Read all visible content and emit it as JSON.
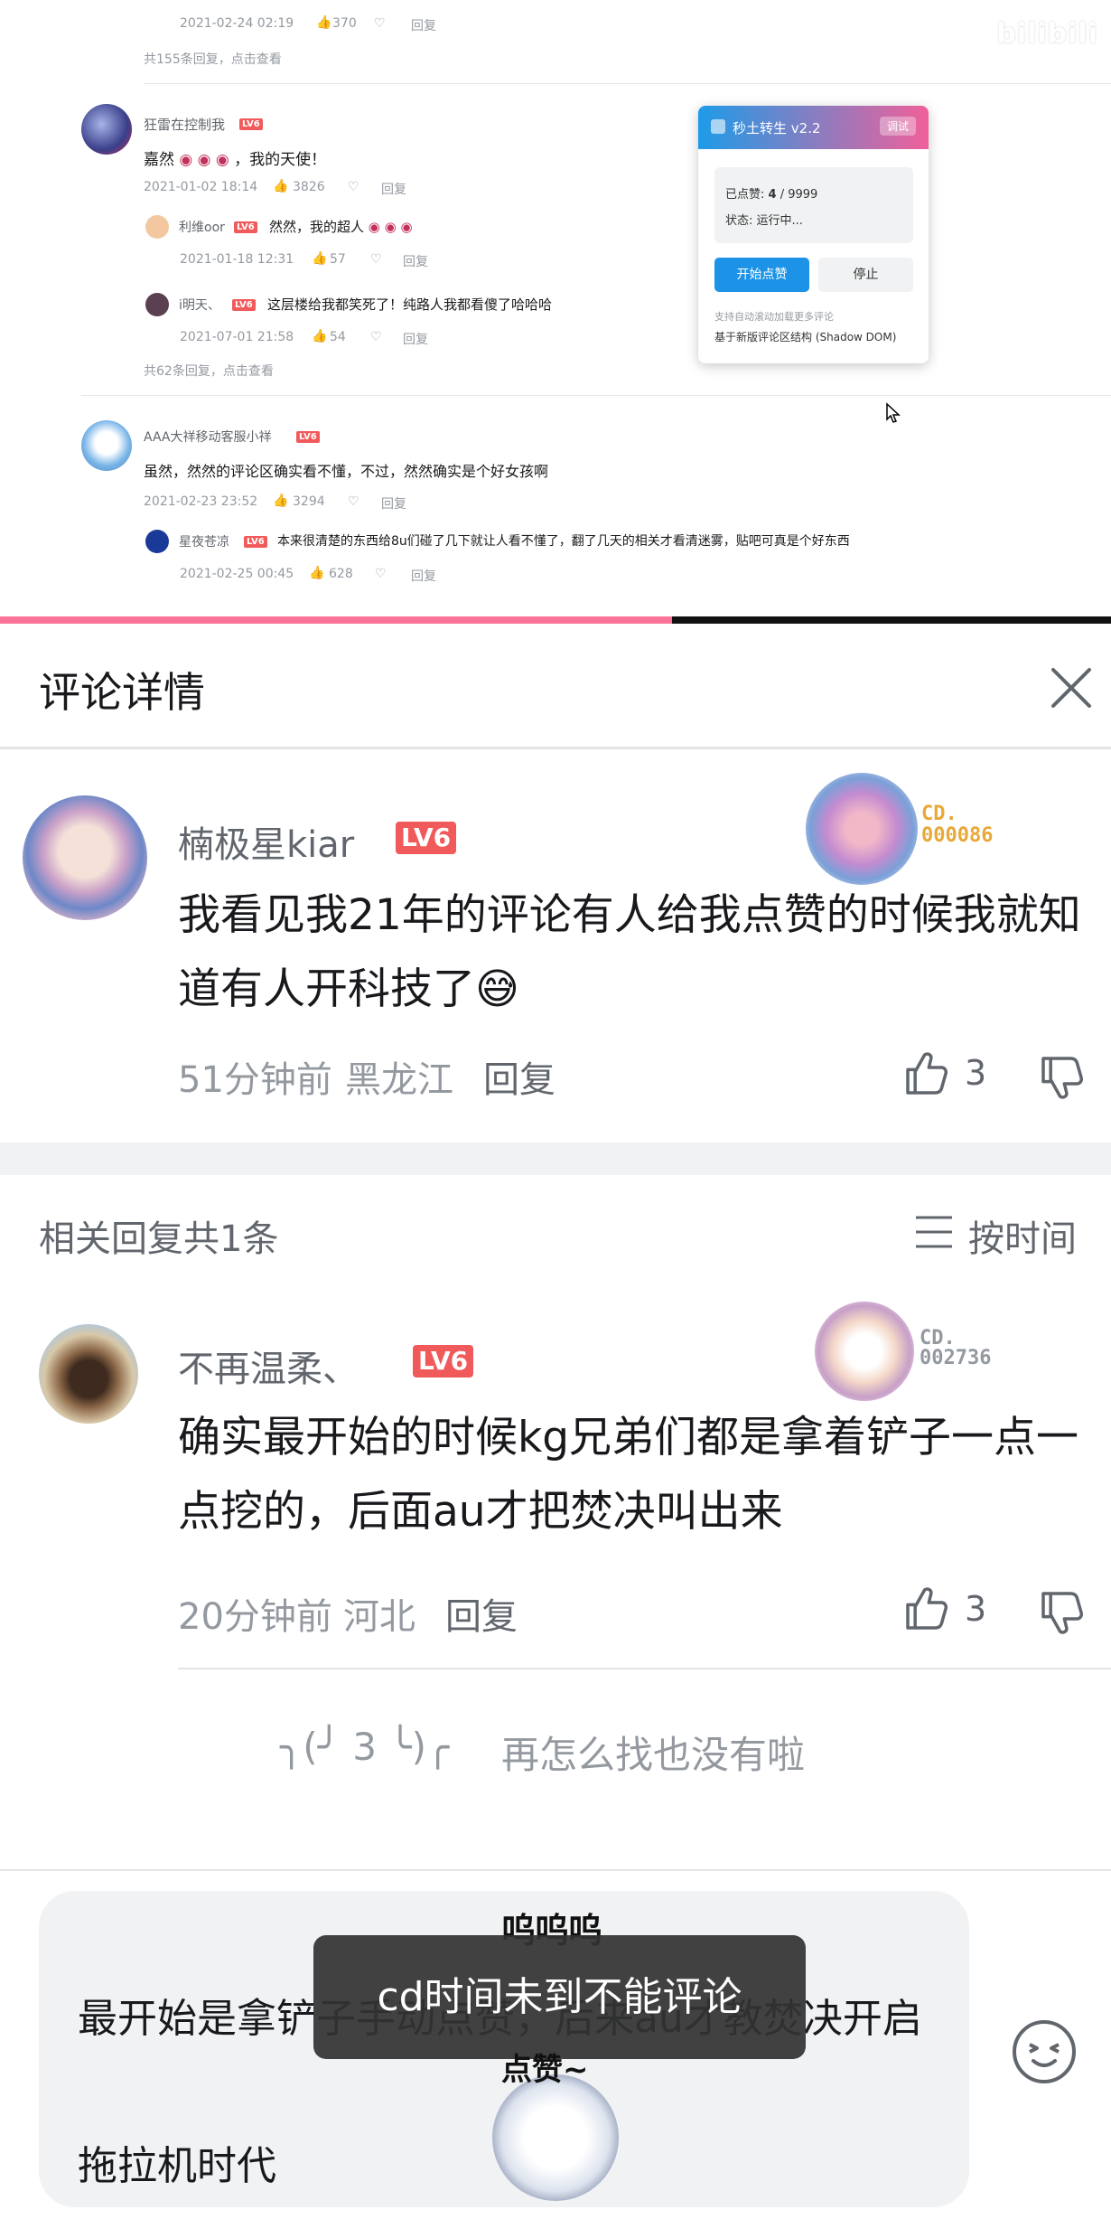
{
  "video": {
    "watermark": "bilibili",
    "c0": {
      "time": "2021-02-24 02:19",
      "likes": "370",
      "reply": "回复",
      "more": "共155条回复，点击查看"
    },
    "c1": {
      "user": "狂雷在控制我",
      "level": "LV6",
      "text": "嘉然",
      "text2": "，我的天使！",
      "time": "2021-01-02 18:14",
      "likes": "3826",
      "reply": "回复"
    },
    "r1": {
      "user": "利维oor",
      "level": "LV6",
      "text": "然然，我的超人",
      "time": "2021-01-18 12:31",
      "likes": "57",
      "reply": "回复"
    },
    "r2": {
      "user": "i明天、",
      "level": "LV6",
      "text": "这层楼给我都笑死了！纯路人我都看傻了哈哈哈",
      "time": "2021-07-01 21:58",
      "likes": "54",
      "reply": "回复",
      "more": "共62条回复，点击查看"
    },
    "c2": {
      "user": "AAA大祥移动客服小祥",
      "level": "LV6",
      "text": "虽然，然然的评论区确实看不懂，不过，然然确实是个好女孩啊",
      "time": "2021-02-23 23:52",
      "likes": "3294",
      "reply": "回复"
    },
    "r3": {
      "user": "星夜苍凉",
      "level": "LV6",
      "text": "本来很清楚的东西给8u们碰了几下就让人看不懂了",
      "text2": "，翻了几天的相关才看清迷雾，贴吧可真是个好东西",
      "time": "2021-02-25 00:45",
      "likes": "628",
      "reply": "回复"
    },
    "plugin": {
      "title": "秒土转生 v2.2",
      "debug": "调试",
      "liked_label": "已点赞: ",
      "liked_value": "4",
      "liked_total": " / 9999",
      "status": "状态: 运行中...",
      "start": "开始点赞",
      "stop": "停止",
      "note1": "支持自动滚动加载更多评论",
      "note2": "基于新版评论区结构 (Shadow DOM)"
    },
    "progress": 0.605
  },
  "panel": {
    "title": "评论详情",
    "main": {
      "user": "楠极星kiar",
      "level": "LV6",
      "fan_label": "CD.",
      "fan_no": "000086",
      "text": "我看见我21年的评论有人给我点赞的时候我就知道有人开科技了😅",
      "time": "51分钟前",
      "location": "黑龙江",
      "reply": "回复",
      "likes": "3"
    },
    "related_label": "相关回复共1条",
    "sort_label": "按时间",
    "reply": {
      "user": "不再温柔、",
      "level": "LV6",
      "fan_label": "CD.",
      "fan_no": "002736",
      "text": "确实最开始的时候kg兄弟们都是拿着铲子一点一点挖的，后面au才把焚决叫出来",
      "time": "20分钟前",
      "location": "河北",
      "reply": "回复",
      "likes": "3"
    },
    "end_face": "╮(╯ 3 ╰)╭",
    "end_text": "再怎么找也没有啦",
    "input_text": "最开始是拿铲子手动点赞，后来au才教焚决开启拖拉机时代",
    "toast": "cd时间未到不能评论",
    "sticker_top": "呜呜呜",
    "sticker_bottom": "点赞~"
  },
  "colors": {
    "accent": "#fb7299",
    "level": "#f15a5a",
    "blue": "#1c93e6"
  }
}
